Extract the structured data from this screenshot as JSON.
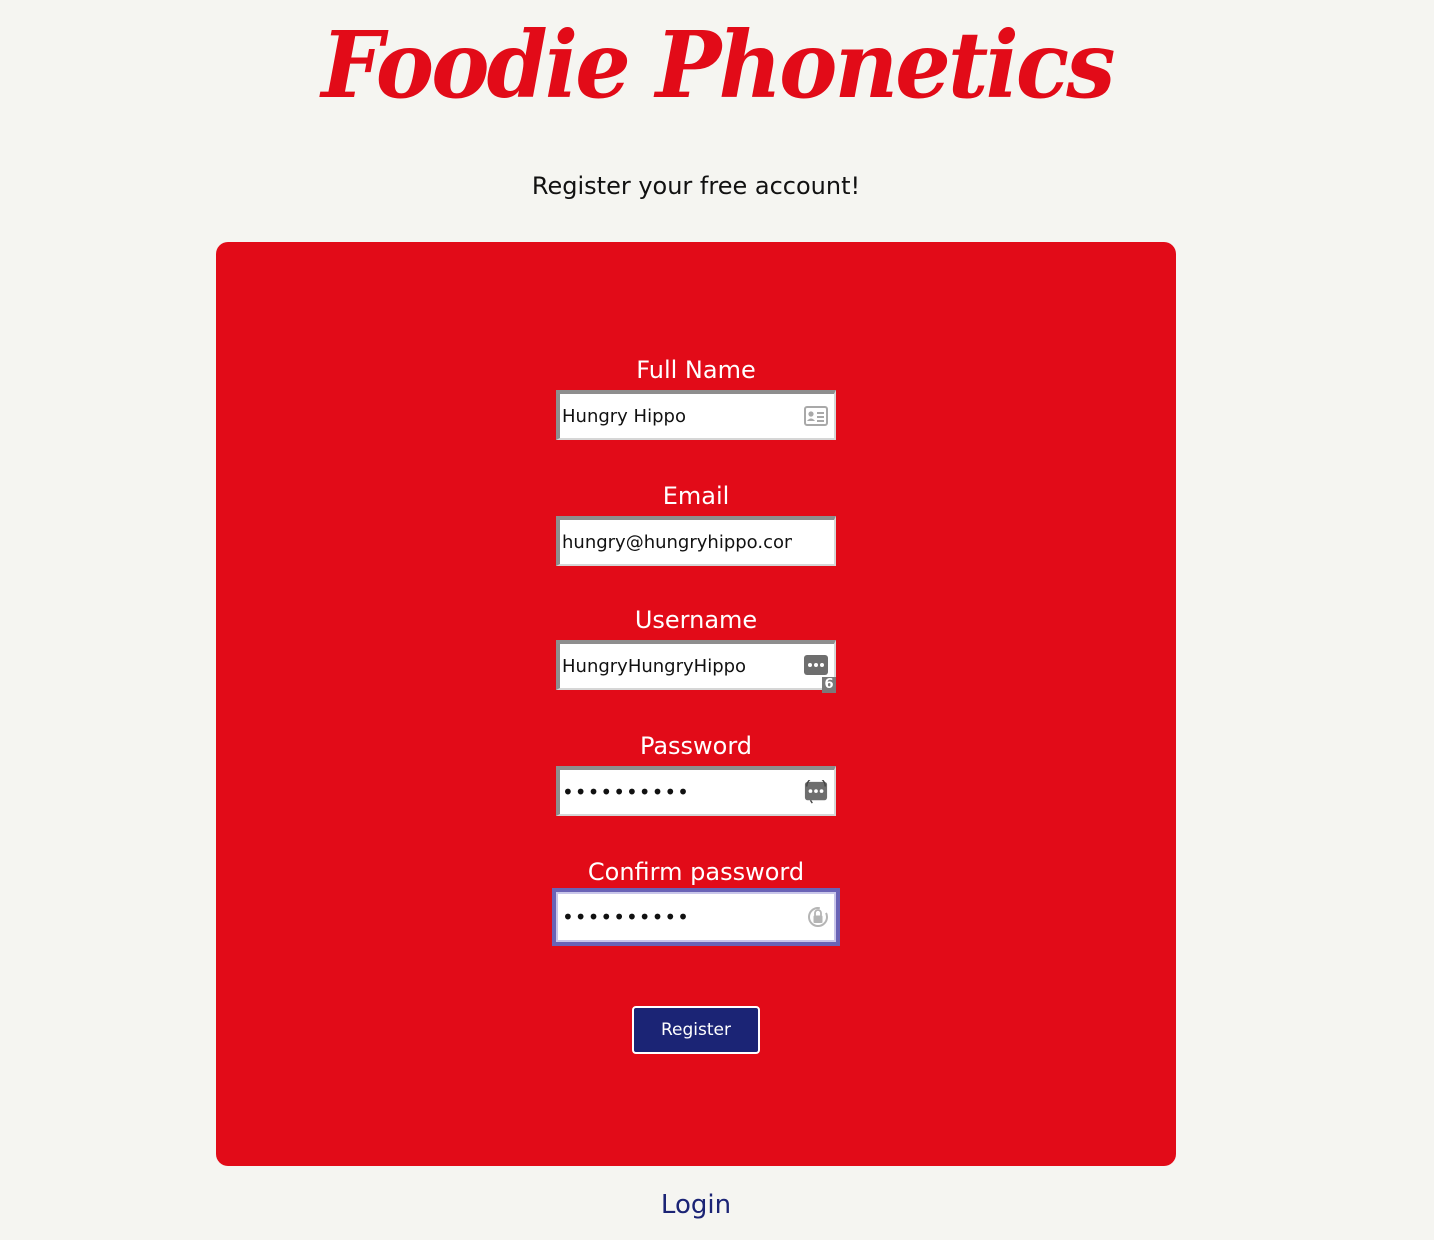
{
  "header": {
    "logo_text": "Foodie Phonetics",
    "subtitle": "Register your free account!"
  },
  "form": {
    "full_name": {
      "label": "Full Name",
      "value": "Hungry Hippo",
      "icon": "contact-card-icon"
    },
    "email": {
      "label": "Email",
      "value": "hungry@hungryhippo.com"
    },
    "username": {
      "label": "Username",
      "value": "HungryHungryHippo",
      "icon": "password-manager-icon",
      "badge": "6"
    },
    "password": {
      "label": "Password",
      "value": "••••••••••",
      "icon": "password-manager-icon"
    },
    "confirm_password": {
      "label": "Confirm password",
      "value": "••••••••••",
      "icon": "lock-icon",
      "focused": true
    },
    "submit_label": "Register"
  },
  "footer": {
    "login_label": "Login"
  },
  "colors": {
    "brand_red": "#e20b18",
    "button_navy": "#1b2475",
    "background": "#f5f5f1",
    "focus_ring": "#6a63b6"
  }
}
